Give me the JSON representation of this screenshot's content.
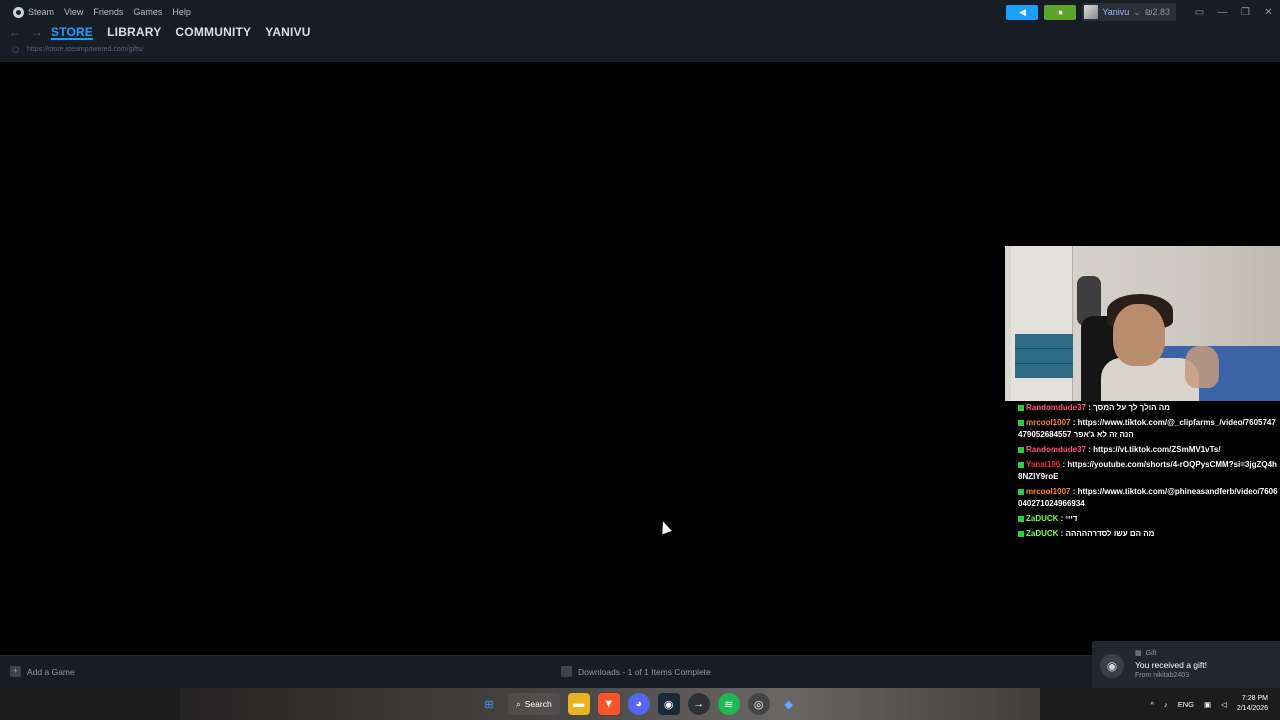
{
  "menu": {
    "app": "Steam",
    "items": [
      "View",
      "Friends",
      "Games",
      "Help"
    ]
  },
  "account": {
    "name": "Yanivu",
    "wallet": "₪2.83"
  },
  "nav": {
    "back_icon": "arrow-left-icon",
    "forward_icon": "arrow-right-icon",
    "tabs": [
      "STORE",
      "LIBRARY",
      "COMMUNITY",
      "YANIVU"
    ],
    "active_tab": "STORE",
    "url": "https://store.steampowered.com/gifts/"
  },
  "chat": [
    {
      "user": "Randomdude37",
      "color": "#ff4f7b",
      "text": " : מה הולך לך על המסך"
    },
    {
      "user": "mrcool1007",
      "color": "#ff8c1a",
      "text": " : https://www.tiktok.com/@_clipfarms_/video/7605747479052684557 הנה זה לא ג'אפר"
    },
    {
      "user": "Randomdude37",
      "color": "#ff4f7b",
      "text": " : https://vt.tiktok.com/ZSmMV1vTs/"
    },
    {
      "user": "Yanai196",
      "color": "#ff2a2a",
      "text": " : https://youtube.com/shorts/4-rOQPysCMM?si=3jgZQ4h8NZlY9roE"
    },
    {
      "user": "mrcool1007",
      "color": "#ff8c1a",
      "text": " : https://www.tiktok.com/@phineasandferb/video/7606040271024966934"
    },
    {
      "user": "ZaDUCK",
      "color": "#7cff3a",
      "text": " : דייי"
    },
    {
      "user": "ZaDUCK",
      "color": "#7cff3a",
      "text": " : מה הם עשו לסדרההההה"
    }
  ],
  "bottom": {
    "add_game": "Add a Game",
    "downloads": "Downloads - 1 of 1 Items Complete"
  },
  "gift_toast": {
    "category": "Gift",
    "title": "You received a gift!",
    "from": "From nikitab2403"
  },
  "taskbar": {
    "search": "Search",
    "lang": "ENG",
    "time": "7:28 PM",
    "date": "2/14/2026"
  },
  "colors": {
    "accent": "#1a9fff",
    "notify": "#5ba32b",
    "bar": "#171d25"
  }
}
